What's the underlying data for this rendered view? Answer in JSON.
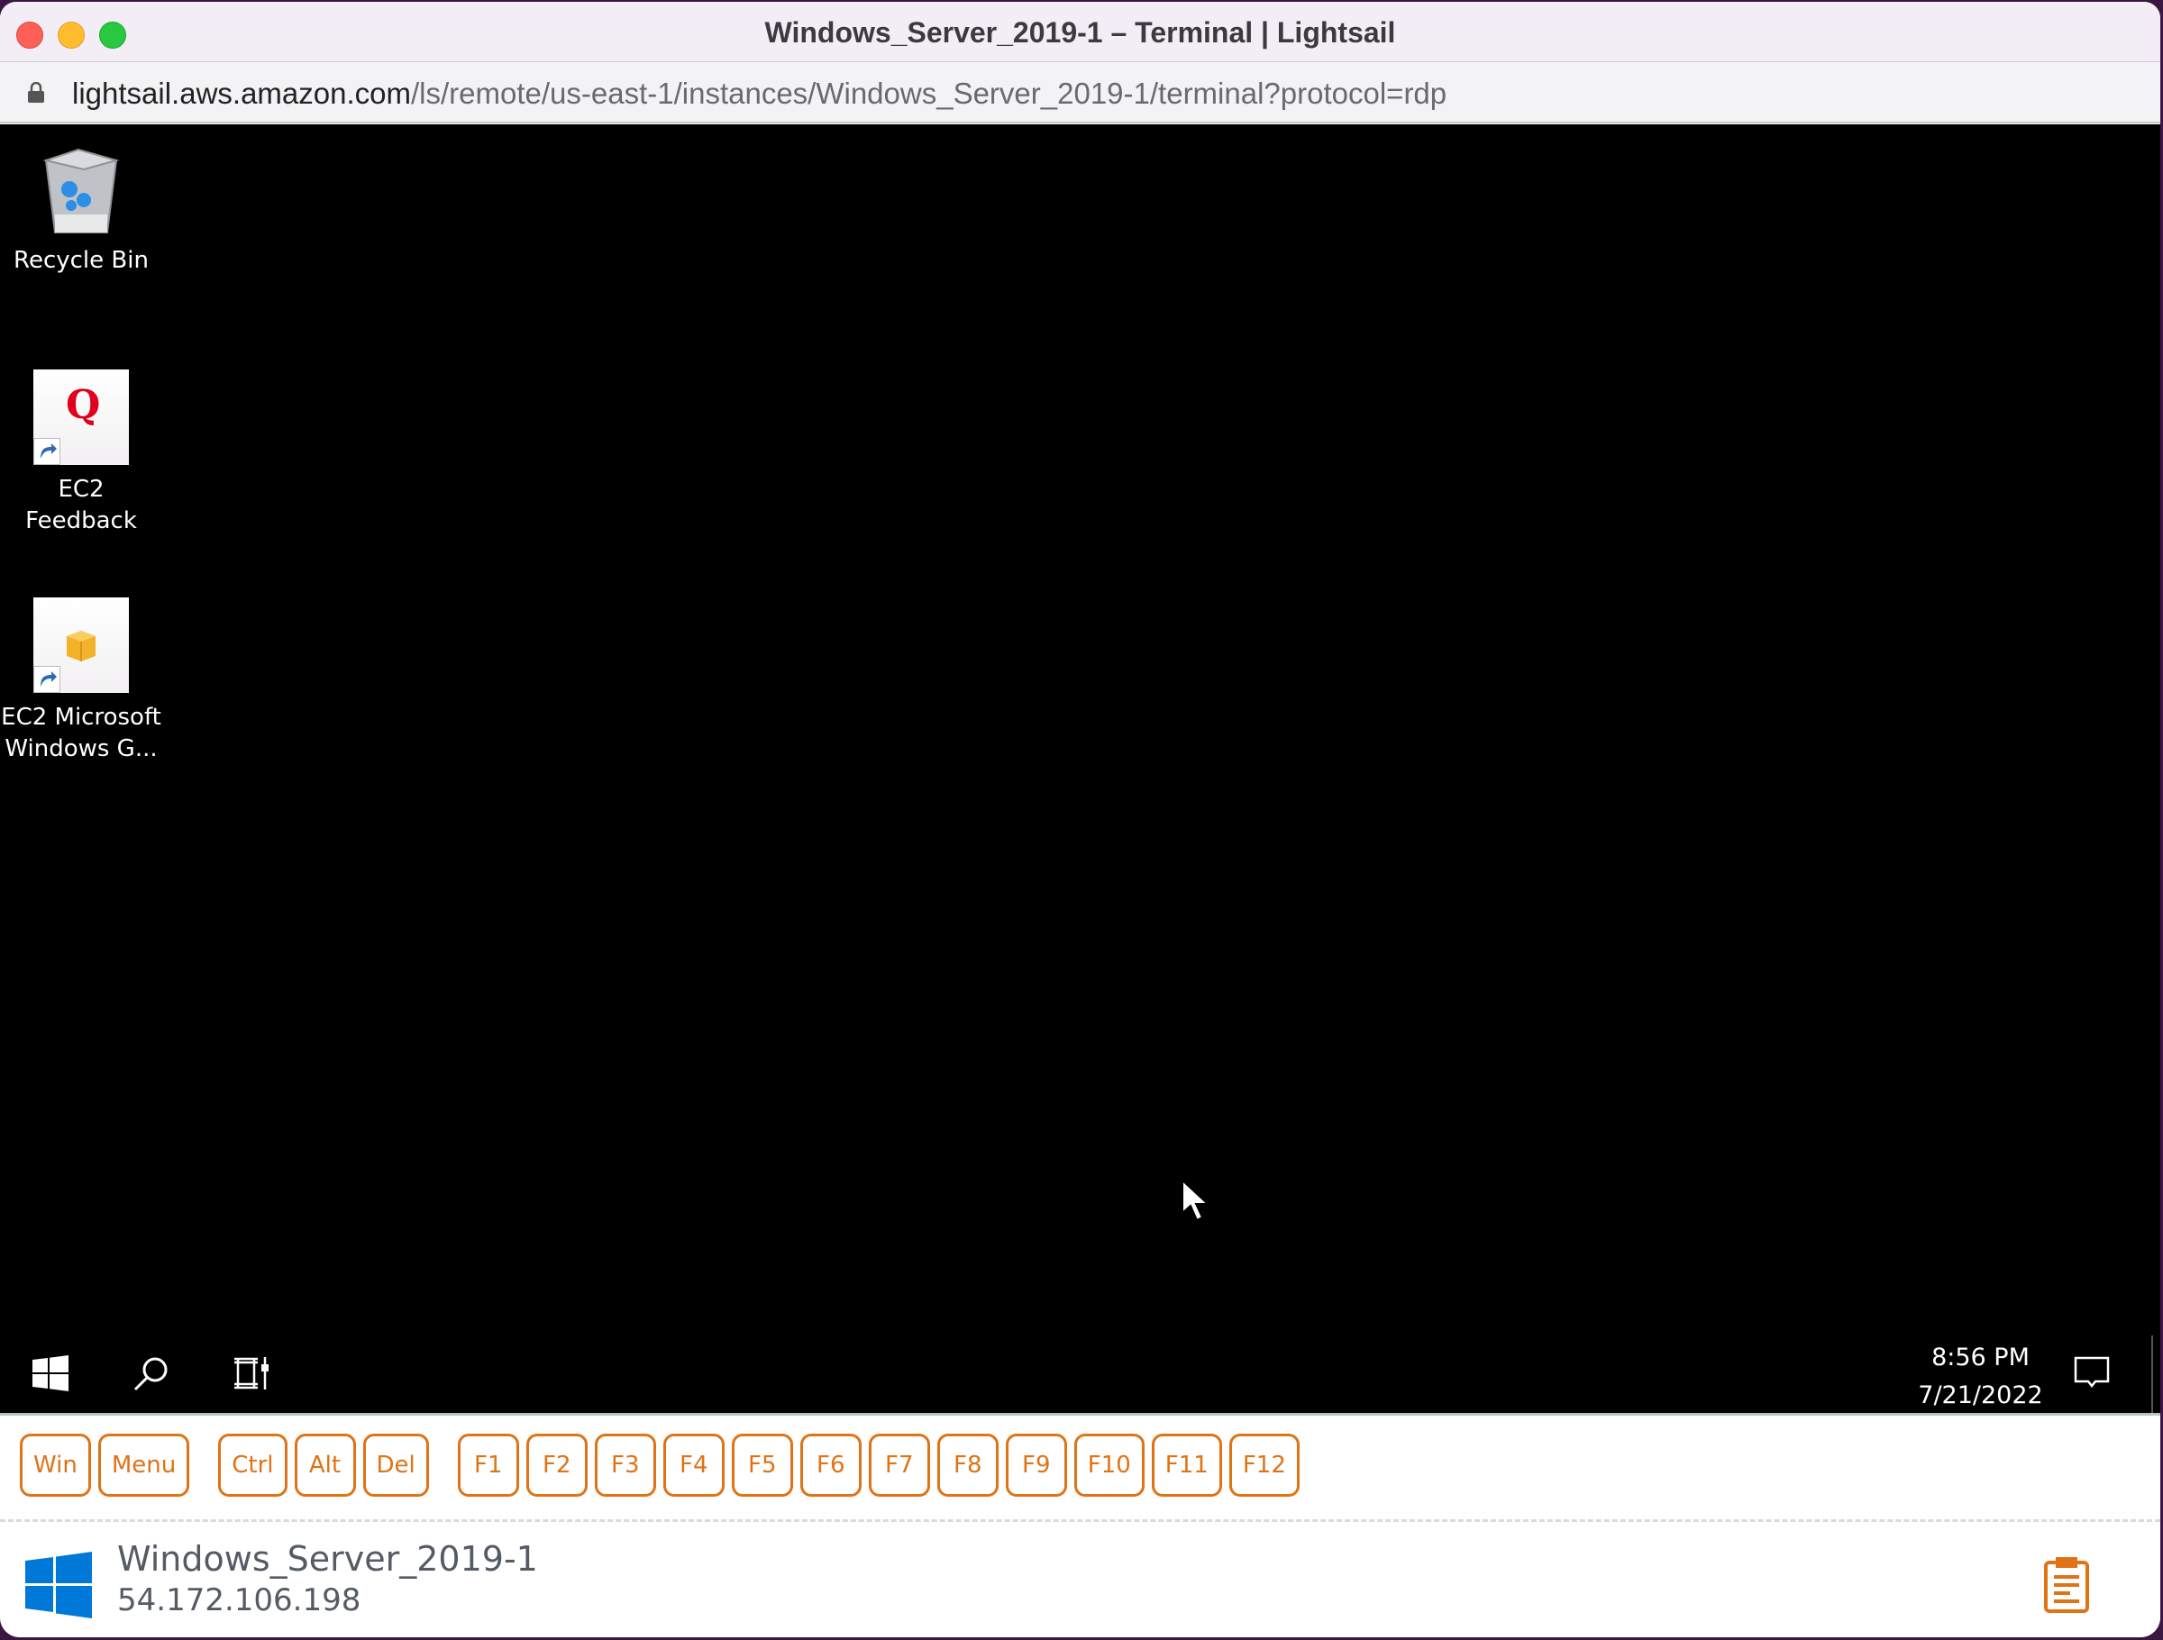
{
  "window": {
    "title": "Windows_Server_2019-1 – Terminal | Lightsail",
    "url_host": "lightsail.aws.amazon.com",
    "url_path": "/ls/remote/us-east-1/instances/Windows_Server_2019-1/terminal?protocol=rdp"
  },
  "desktop": {
    "icons": [
      {
        "label": "Recycle Bin",
        "icon": "recycle-bin-icon"
      },
      {
        "label": "EC2 Feedback",
        "icon": "ec2-feedback-icon"
      },
      {
        "label": "EC2 Microsoft Windows G...",
        "icon": "ec2-package-icon"
      }
    ]
  },
  "taskbar": {
    "time": "8:56 PM",
    "date": "7/21/2022",
    "icons": [
      "windows-start-icon",
      "search-icon",
      "task-view-icon",
      "action-center-icon"
    ]
  },
  "keys": {
    "group1": [
      "Win",
      "Menu"
    ],
    "group2": [
      "Ctrl",
      "Alt",
      "Del"
    ],
    "group3": [
      "F1",
      "F2",
      "F3",
      "F4",
      "F5",
      "F6",
      "F7",
      "F8",
      "F9",
      "F10",
      "F11",
      "F12"
    ]
  },
  "instance": {
    "name": "Windows_Server_2019-1",
    "ip": "54.172.106.198"
  },
  "colors": {
    "accent": "#e07316",
    "windows_blue": "#0078d7"
  }
}
